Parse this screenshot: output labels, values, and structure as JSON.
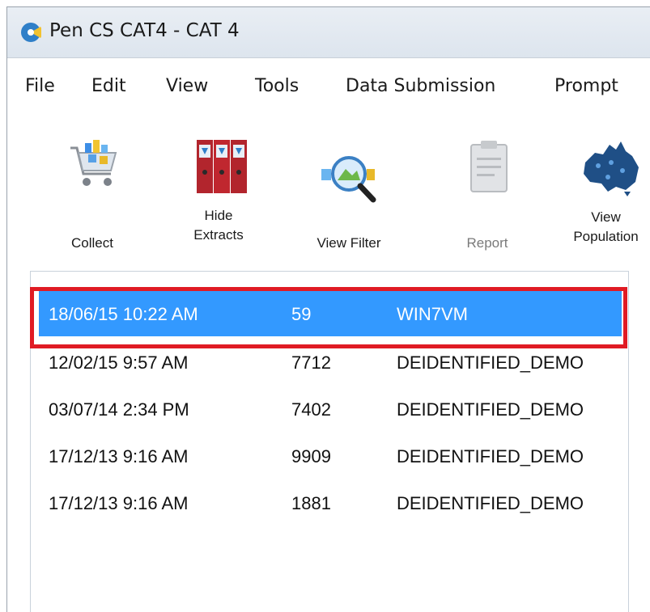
{
  "window": {
    "title": "Pen CS CAT4 - CAT 4"
  },
  "menu": [
    "File",
    "Edit",
    "View",
    "Tools",
    "Data Submission",
    "Prompt"
  ],
  "toolbar": {
    "collect": "Collect",
    "hide_line1": "Hide",
    "hide_line2": "Extracts",
    "view_filter": "View Filter",
    "report": "Report",
    "pop_line1": "View",
    "pop_line2": "Population"
  },
  "extracts": [
    {
      "date": "18/06/15 10:22 AM",
      "count": "59",
      "name": "WIN7VM"
    },
    {
      "date": "12/02/15 9:57 AM",
      "count": "7712",
      "name": "DEIDENTIFIED_DEMO"
    },
    {
      "date": "03/07/14 2:34 PM",
      "count": "7402",
      "name": "DEIDENTIFIED_DEMO"
    },
    {
      "date": "17/12/13 9:16 AM",
      "count": "9909",
      "name": "DEIDENTIFIED_DEMO"
    },
    {
      "date": "17/12/13 9:16 AM",
      "count": "1881",
      "name": "DEIDENTIFIED_DEMO"
    }
  ],
  "colors": {
    "selection": "#3399ff",
    "highlight_box": "#e01b24"
  },
  "icons": [
    "app-logo-icon",
    "shopping-cart-icon",
    "binders-icon",
    "magnifier-icon",
    "clipboard-icon",
    "australia-map-icon"
  ]
}
